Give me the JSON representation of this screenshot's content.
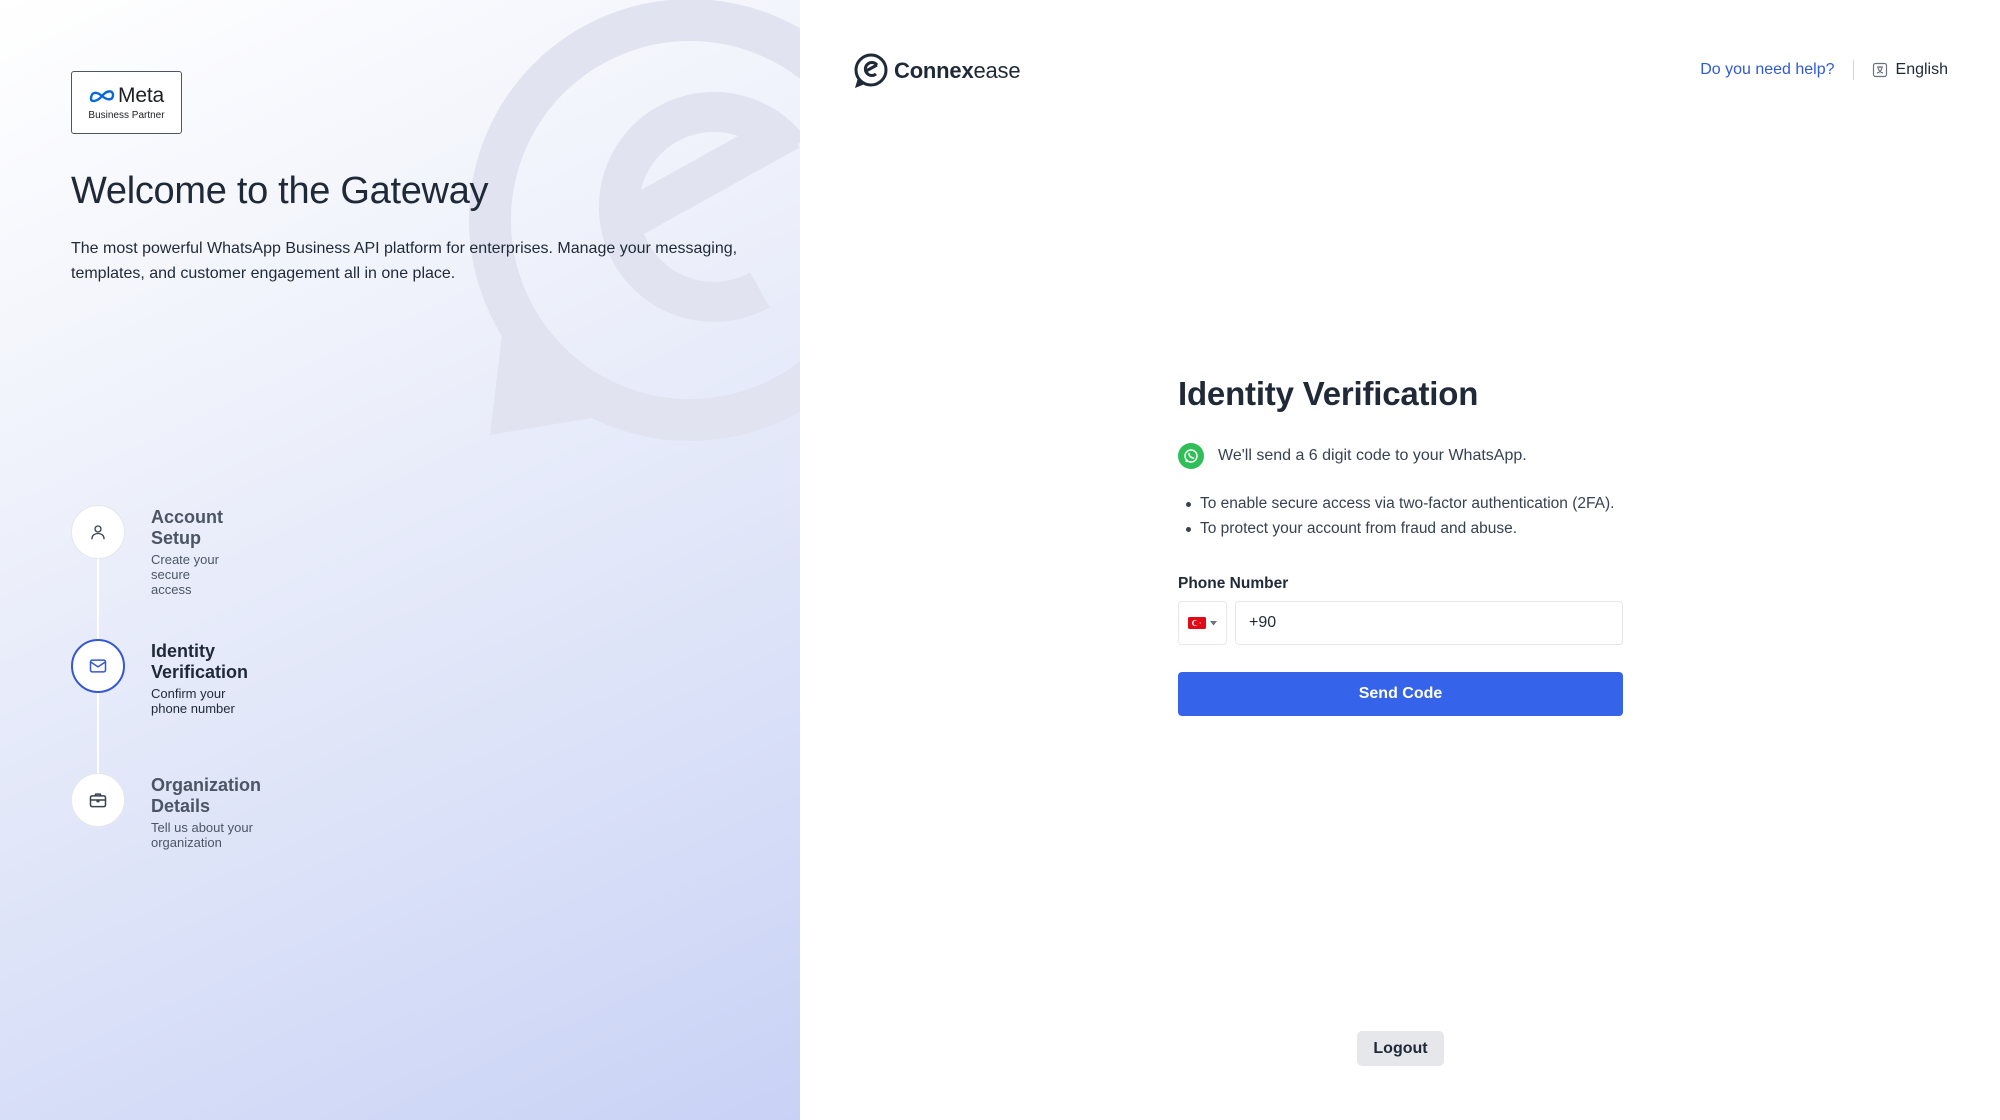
{
  "left_panel": {
    "meta_badge": {
      "brand": "Meta",
      "subtitle": "Business Partner"
    },
    "title": "Welcome to the Gateway",
    "description": "The most powerful WhatsApp Business API platform for enterprises. Manage your messaging, templates, and customer engagement all in one place.",
    "steps": [
      {
        "title": "Account Setup",
        "subtitle": "Create your secure access",
        "icon": "user-icon",
        "active": false
      },
      {
        "title": "Identity Verification",
        "subtitle": "Confirm your phone number",
        "icon": "mail-icon",
        "active": true
      },
      {
        "title": "Organization Details",
        "subtitle": "Tell us about your organization",
        "icon": "briefcase-icon",
        "active": false
      }
    ]
  },
  "header": {
    "brand_bold": "Connex",
    "brand_light": "ease",
    "help_link": "Do you need help?",
    "language": "English"
  },
  "verification": {
    "title": "Identity Verification",
    "whatsapp_note": "We'll send a 6 digit code to your WhatsApp.",
    "bullets": [
      "To enable secure access via two-factor authentication (2FA).",
      "To protect your account from fraud and abuse."
    ],
    "phone_label": "Phone Number",
    "country_flag": "turkey-flag-icon",
    "phone_value": "+90",
    "send_button": "Send Code"
  },
  "footer": {
    "logout_button": "Logout"
  },
  "colors": {
    "accent": "#3563e9",
    "link": "#2f5ad6",
    "whatsapp": "#2fbe57",
    "active_step": "#3557d4"
  }
}
